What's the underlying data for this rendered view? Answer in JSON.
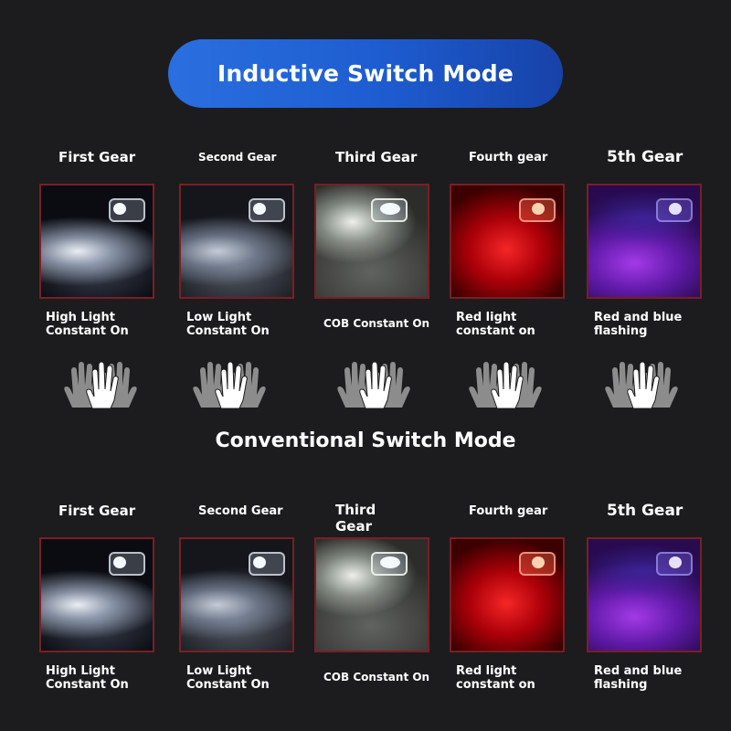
{
  "header": {
    "title": "Inductive Switch Mode"
  },
  "second_section": {
    "title": "Conventional Switch Mode"
  },
  "inductive": {
    "gears": [
      {
        "label": "First Gear",
        "desc1": "High Light",
        "desc2": "Constant On"
      },
      {
        "label": "Second Gear",
        "desc1": "Low Light",
        "desc2": "Constant On"
      },
      {
        "label": "Third Gear",
        "desc1": "COB Constant On",
        "desc2": ""
      },
      {
        "label": "Fourth gear",
        "desc1": "Red light",
        "desc2": "constant on"
      },
      {
        "label": "5th Gear",
        "desc1": "Red and blue",
        "desc2": "flashing"
      }
    ]
  },
  "conventional": {
    "gears": [
      {
        "label": "First Gear",
        "desc1": "High Light",
        "desc2": "Constant On"
      },
      {
        "label": "Second Gear",
        "desc1": "Low Light",
        "desc2": "Constant On"
      },
      {
        "label": "Third Gear",
        "desc1": "COB Constant On",
        "desc2": ""
      },
      {
        "label": "Fourth gear",
        "desc1": "Red light",
        "desc2": "constant on"
      },
      {
        "label": "5th Gear",
        "desc1": "Red and blue",
        "desc2": "flashing"
      }
    ],
    "third_label_line1": "Third",
    "third_label_line2": "Gear"
  },
  "icons": {
    "hand_gesture": "wave-hands-icon"
  },
  "colors": {
    "banner": "#2a6fe0",
    "background": "#1c1c1e",
    "tile_border": "#7a1f24"
  }
}
